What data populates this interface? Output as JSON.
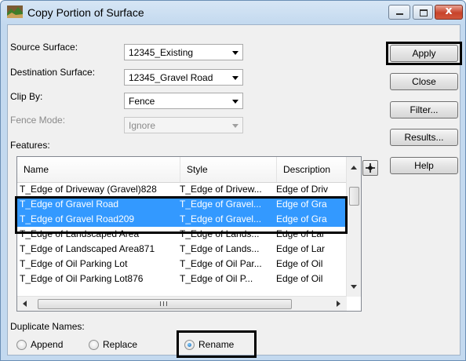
{
  "window": {
    "title": "Copy Portion of Surface",
    "controls": {
      "minimize_icon": "minimize-icon",
      "maximize_icon": "maximize-icon",
      "close_label": "x"
    }
  },
  "form": {
    "source_surface": {
      "label": "Source Surface:",
      "value": "12345_Existing"
    },
    "destination_surface": {
      "label": "Destination Surface:",
      "value": "12345_Gravel Road"
    },
    "clip_by": {
      "label": "Clip By:",
      "value": "Fence"
    },
    "fence_mode": {
      "label": "Fence Mode:",
      "value": "Ignore",
      "disabled": true
    }
  },
  "buttons": {
    "apply": "Apply",
    "close": "Close",
    "filter": "Filter...",
    "results": "Results...",
    "help": "Help"
  },
  "features": {
    "label": "Features:",
    "columns": [
      "Name",
      "Style",
      "Description"
    ],
    "rows": [
      {
        "name": "T_Edge of Driveway (Gravel)828",
        "style": "T_Edge of Drivew...",
        "description": "Edge of Driv",
        "selected": false
      },
      {
        "name": "T_Edge of Gravel Road",
        "style": "T_Edge of Gravel...",
        "description": "Edge of Gra",
        "selected": true
      },
      {
        "name": "T_Edge of Gravel Road209",
        "style": "T_Edge of Gravel...",
        "description": "Edge of Gra",
        "selected": true
      },
      {
        "name": "T_Edge of Landscaped Area",
        "style": "T_Edge of Lands...",
        "description": "Edge of Lar",
        "selected": false
      },
      {
        "name": "T_Edge of Landscaped Area871",
        "style": "T_Edge of Lands...",
        "description": "Edge of Lar",
        "selected": false
      },
      {
        "name": "T_Edge of Oil Parking Lot",
        "style": "T_Edge of Oil Par...",
        "description": "Edge of Oil",
        "selected": false
      },
      {
        "name": "T_Edge of Oil Parking Lot876",
        "style": "T_Edge of Oil P...",
        "description": "Edge of Oil",
        "selected": false
      }
    ],
    "selection_color": "#3399ff"
  },
  "duplicate_names": {
    "label": "Duplicate Names:",
    "options": [
      {
        "label": "Append",
        "checked": false
      },
      {
        "label": "Replace",
        "checked": false
      },
      {
        "label": "Rename",
        "checked": true
      }
    ]
  }
}
